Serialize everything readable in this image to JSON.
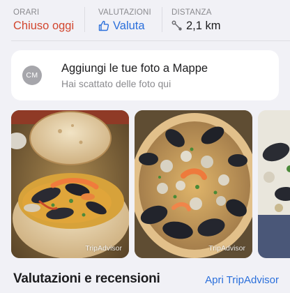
{
  "info": {
    "hours": {
      "label": "ORARI",
      "value": "Chiuso oggi"
    },
    "ratings": {
      "label": "VALUTAZIONI",
      "value": "Valuta",
      "icon": "thumbs-up-icon"
    },
    "distance": {
      "label": "DISTANZA",
      "value": "2,1 km",
      "icon": "route-icon"
    }
  },
  "add_photos": {
    "avatar_initials": "CM",
    "title": "Aggiungi le tue foto a Mappe",
    "subtitle": "Hai scattato delle foto qui"
  },
  "photos": [
    {
      "subject": "seafood pizza with clams and mussels in bread bowl",
      "credit": "TripAdvisor"
    },
    {
      "subject": "seafood pizza with mussels, clams and shrimp",
      "credit": "TripAdvisor"
    },
    {
      "subject": "seafood plate (partially visible)",
      "credit": ""
    }
  ],
  "reviews": {
    "title": "Valutazioni e recensioni",
    "link": "Apri TripAdvisor"
  },
  "colors": {
    "background": "#f1f1f6",
    "closed_red": "#d2462e",
    "link_blue": "#2a6fdb",
    "secondary_gray": "#8a8a8e"
  }
}
